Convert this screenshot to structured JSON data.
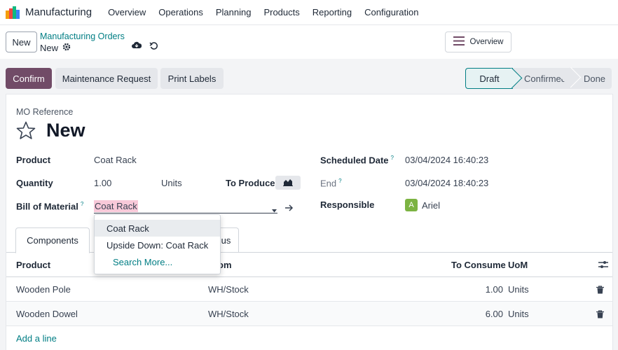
{
  "navbar": {
    "app_name": "Manufacturing",
    "menu": [
      "Overview",
      "Operations",
      "Planning",
      "Products",
      "Reporting",
      "Configuration"
    ]
  },
  "control_panel": {
    "new_label": "New",
    "breadcrumb_parent": "Manufacturing Orders",
    "breadcrumb_current": "New",
    "overview_label": "Overview"
  },
  "actions": {
    "confirm": "Confirm",
    "maintenance": "Maintenance Request",
    "print_labels": "Print Labels"
  },
  "stages": {
    "draft": "Draft",
    "confirmed": "Confirmed",
    "done": "Done"
  },
  "form": {
    "ref_label": "MO Reference",
    "title": "New",
    "product_label": "Product",
    "product_value": "Coat Rack",
    "quantity_label": "Quantity",
    "quantity_value": "1.00",
    "quantity_uom": "Units",
    "to_produce_label": "To Produce",
    "bom_label": "Bill of Material",
    "bom_value": "Coat Rack",
    "scheduled_label": "Scheduled Date",
    "scheduled_value": "03/04/2024 16:40:23",
    "end_label": "End",
    "end_value": "03/04/2024 18:40:23",
    "responsible_label": "Responsible",
    "responsible_initial": "A",
    "responsible_value": "Ariel",
    "help_mark": "?"
  },
  "tabs": {
    "components": "Components",
    "partial": "us"
  },
  "table": {
    "headers": {
      "product": "Product",
      "from": "om",
      "to_consume": "To Consume",
      "uom": "UoM"
    },
    "rows": [
      {
        "product": "Wooden Pole",
        "from": "WH/Stock",
        "to_consume": "1.00",
        "uom": "Units"
      },
      {
        "product": "Wooden Dowel",
        "from": "WH/Stock",
        "to_consume": "6.00",
        "uom": "Units"
      }
    ],
    "add_line": "Add a line"
  },
  "dropdown": {
    "items": [
      "Coat Rack",
      "Upside Down: Coat Rack"
    ],
    "search_more": "Search More..."
  },
  "colors": {
    "brand": "#714b67",
    "accent": "#017e84",
    "avatar": "#7cb342",
    "highlight": "#f8c9d9"
  }
}
